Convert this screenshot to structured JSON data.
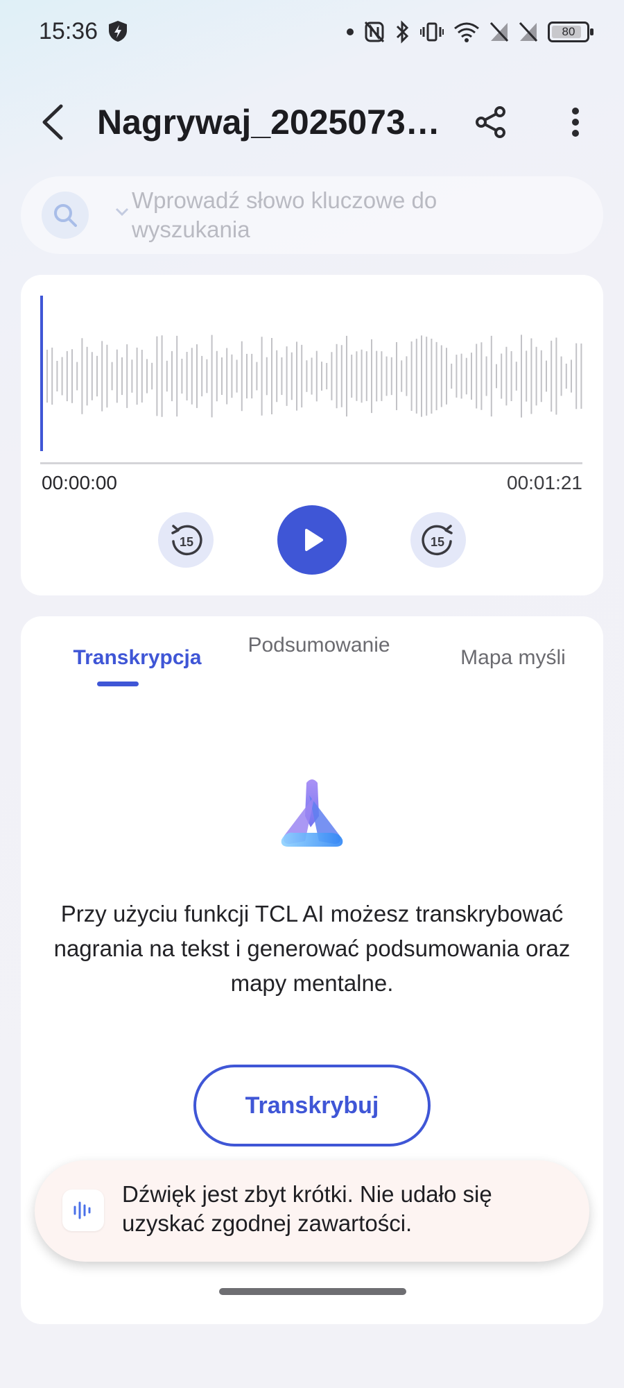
{
  "status_bar": {
    "time": "15:36",
    "battery": "80"
  },
  "app_bar": {
    "title": "Nagrywaj_20250731..."
  },
  "search": {
    "placeholder": "Wprowadź słowo kluczowe do wyszukania"
  },
  "player": {
    "current_time": "00:00:00",
    "total_time": "00:01:21",
    "skip_seconds": "15",
    "accent_color": "#3f56d6"
  },
  "tabs": [
    {
      "label": "Transkrypcja",
      "active": true
    },
    {
      "label": "Podsumowanie",
      "active": false
    },
    {
      "label": "Mapa myśli",
      "active": false
    }
  ],
  "content": {
    "info_text": "Przy użyciu funkcji TCL AI możesz transkrybować nagrania na tekst i generować podsumowania oraz mapy mentalne.",
    "transcribe_label": "Transkrybuj"
  },
  "toast": {
    "message": "Dźwięk jest zbyt krótki. Nie udało się uzyskać zgodnej zawartości."
  }
}
